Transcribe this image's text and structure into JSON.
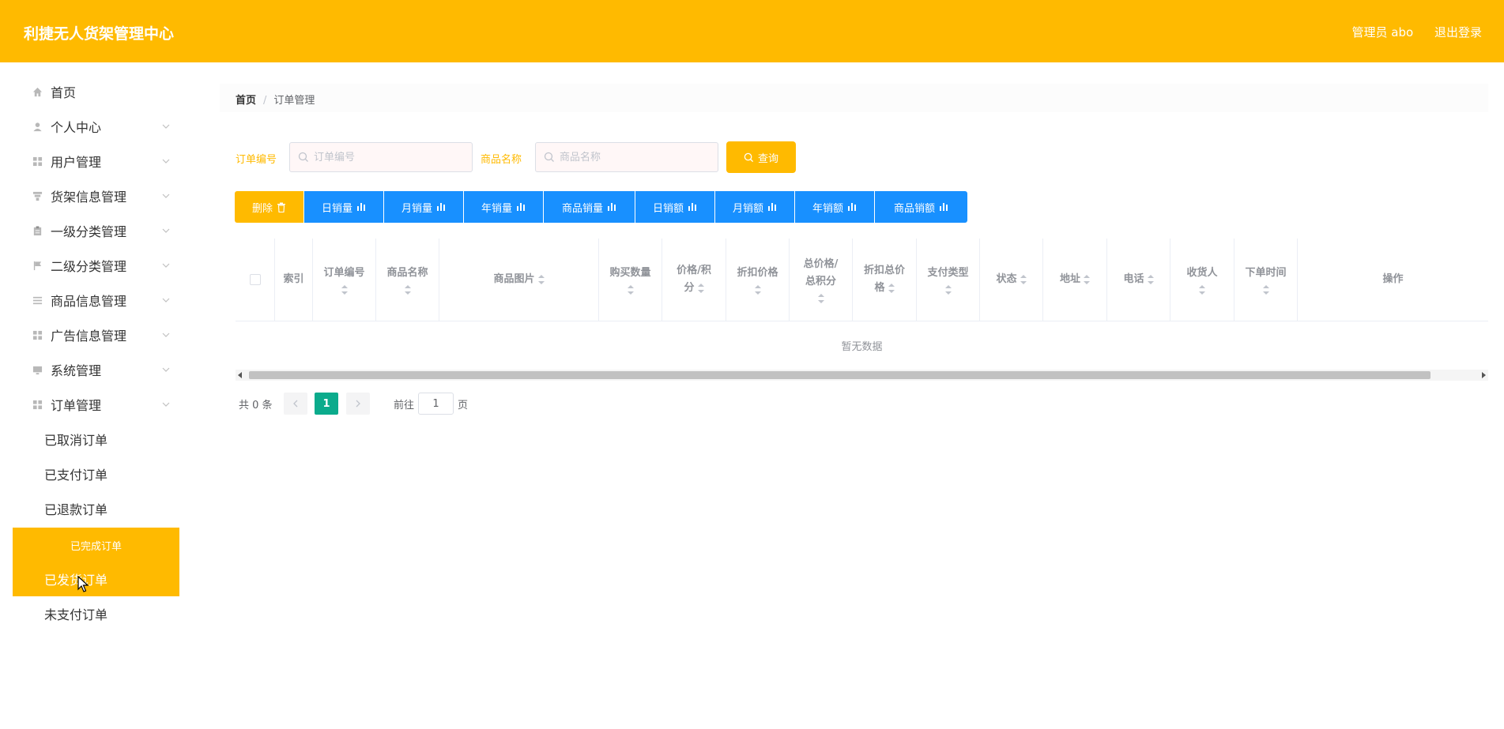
{
  "header": {
    "brand": "利捷无人货架管理中心",
    "user_label": "管理员 abo",
    "logout_label": "退出登录",
    "bg_color": "#ffba00"
  },
  "sidebar": {
    "items": [
      {
        "label": "首页",
        "icon": "home-icon"
      },
      {
        "label": "个人中心",
        "icon": "user-icon"
      },
      {
        "label": "用户管理",
        "icon": "grid-icon"
      },
      {
        "label": "货架信息管理",
        "icon": "shelf-icon"
      },
      {
        "label": "一级分类管理",
        "icon": "clipboard-icon"
      },
      {
        "label": "二级分类管理",
        "icon": "flag-icon"
      },
      {
        "label": "商品信息管理",
        "icon": "list-icon"
      },
      {
        "label": "广告信息管理",
        "icon": "grid-icon"
      },
      {
        "label": "系统管理",
        "icon": "monitor-icon"
      },
      {
        "label": "订单管理",
        "icon": "grid-icon"
      }
    ],
    "order_sub_items": [
      {
        "label": "已取消订单"
      },
      {
        "label": "已支付订单"
      },
      {
        "label": "已退款订单"
      },
      {
        "label": "已完成订单"
      },
      {
        "label": "已发货订单"
      },
      {
        "label": "未支付订单"
      }
    ]
  },
  "breadcrumb": {
    "home": "首页",
    "separator": "/",
    "current": "订单管理"
  },
  "search": {
    "order_no_label": "订单编号",
    "order_no_placeholder": "订单编号",
    "product_name_label": "商品名称",
    "product_name_placeholder": "商品名称",
    "query_label": "查询"
  },
  "toolbar": {
    "delete_label": "删除",
    "buttons": [
      {
        "label": "日销量"
      },
      {
        "label": "月销量"
      },
      {
        "label": "年销量"
      },
      {
        "label": "商品销量"
      },
      {
        "label": "日销额"
      },
      {
        "label": "月销额"
      },
      {
        "label": "年销额"
      },
      {
        "label": "商品销额"
      }
    ]
  },
  "table": {
    "columns": [
      {
        "label": "索引"
      },
      {
        "label_lines": [
          "订单编号"
        ]
      },
      {
        "label_lines": [
          "商品名称"
        ]
      },
      {
        "label": "商品图片"
      },
      {
        "label_lines": [
          "购买数量"
        ]
      },
      {
        "label_lines": [
          "价格/积",
          "分"
        ]
      },
      {
        "label_lines": [
          "折扣价格"
        ]
      },
      {
        "label_lines": [
          "总价格/",
          "总积分"
        ]
      },
      {
        "label_lines": [
          "折扣总价",
          "格"
        ]
      },
      {
        "label_lines": [
          "支付类型"
        ]
      },
      {
        "label": "状态"
      },
      {
        "label": "地址"
      },
      {
        "label": "电话"
      },
      {
        "label_lines": [
          "收货人"
        ]
      },
      {
        "label_lines": [
          "下单时间"
        ]
      },
      {
        "label": "操作"
      }
    ],
    "empty_text": "暂无数据"
  },
  "pagination": {
    "total_text": "共 0 条",
    "current_page": "1",
    "goto_label": "前往",
    "goto_value": "1",
    "page_suffix": "页"
  }
}
